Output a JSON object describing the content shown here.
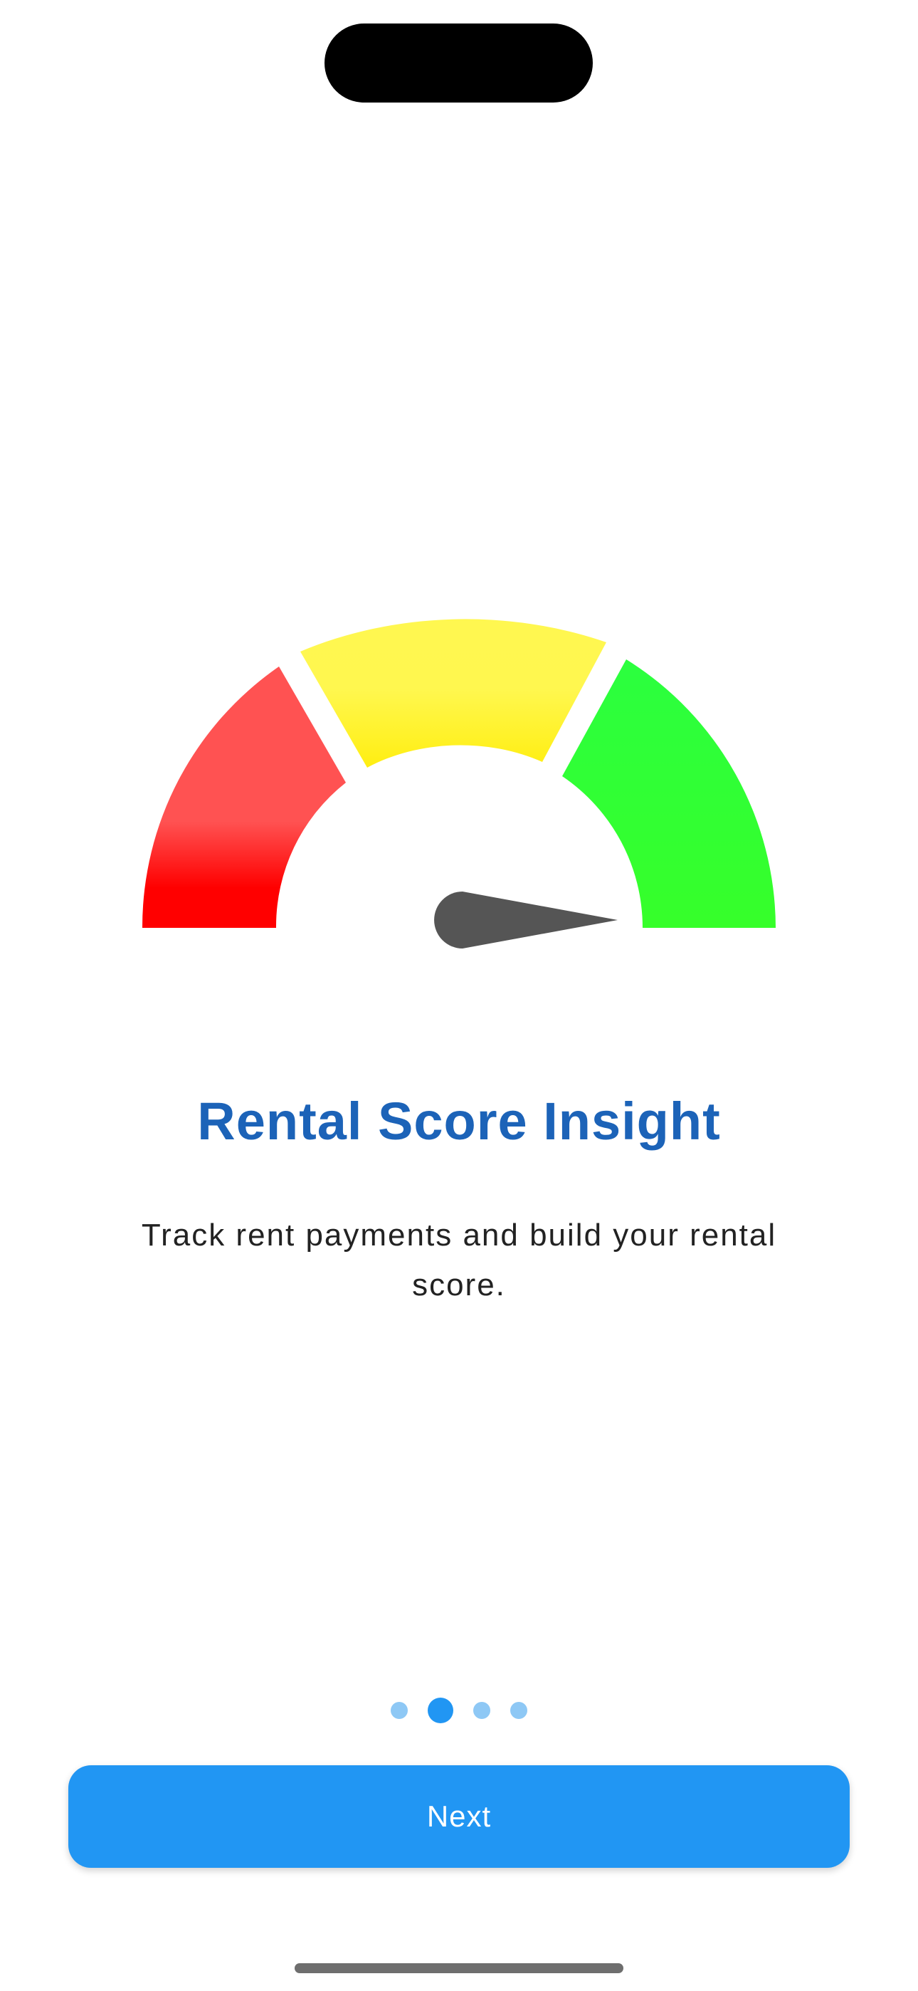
{
  "onboarding": {
    "title": "Rental Score Insight",
    "description": "Track rent payments and build your rental score.",
    "next_label": "Next"
  },
  "gauge": {
    "segments": [
      {
        "name": "low",
        "color": "#ff0000"
      },
      {
        "name": "medium",
        "color": "#ffff33"
      },
      {
        "name": "high",
        "color": "#33ff33"
      }
    ],
    "needle_color": "#555555"
  },
  "pager": {
    "count": 4,
    "active_index": 1,
    "active_color": "#2196f3",
    "inactive_color": "#8ec8f5"
  },
  "colors": {
    "title": "#1c63b8",
    "button": "#2196f3"
  }
}
